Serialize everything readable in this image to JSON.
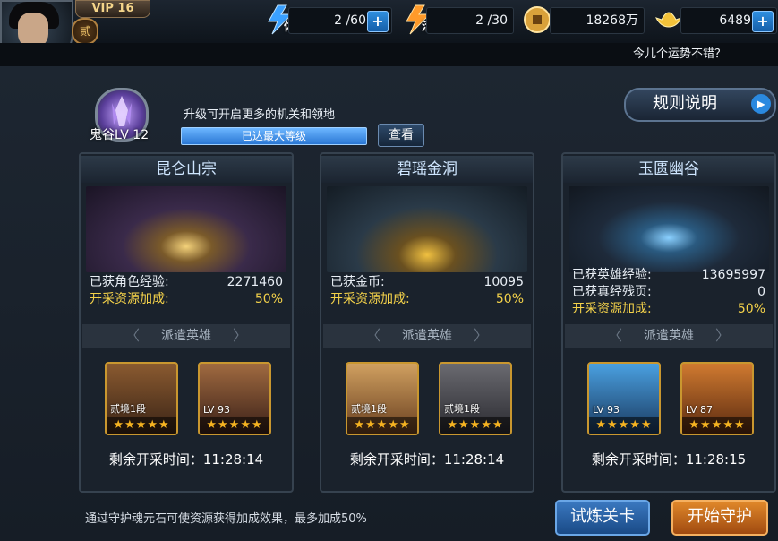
{
  "player": {
    "vip": "VIP 16",
    "rank_badge": "贰"
  },
  "resources": [
    {
      "icon": "stamina-icon",
      "label": "体",
      "value": "2 /60",
      "has_plus": true
    },
    {
      "icon": "energy-icon",
      "label": "活",
      "value": "2 /30",
      "has_plus": false
    },
    {
      "icon": "coin-icon",
      "label": "",
      "value": "18268万",
      "has_plus": false
    },
    {
      "icon": "gold-ingot-icon",
      "label": "",
      "value": "6489",
      "has_plus": true
    }
  ],
  "fortune_text": "今儿个运势不错？",
  "level": {
    "name": "鬼谷LV 12",
    "hint": "升级可开启更多的机关和领地",
    "bar_text": "已达最大等级",
    "progress": 1.0,
    "view_button": "查看"
  },
  "rules_button": "规则说明",
  "panels": [
    {
      "title": "昆仑山宗",
      "stats": [
        {
          "k": "已获角色经验:",
          "v": "2271460",
          "highlight": false
        },
        {
          "k": "开采资源加成:",
          "v": "50%",
          "highlight": true
        }
      ],
      "dispatch": "派遣英雄",
      "heroes": [
        {
          "lv": "贰境1段",
          "stars": "★★★★★"
        },
        {
          "lv": "LV 93",
          "stars": "★★★★★"
        }
      ],
      "timer": "剩余开采时间：11:28:14"
    },
    {
      "title": "碧瑶金洞",
      "stats": [
        {
          "k": "已获金币:",
          "v": "10095",
          "highlight": false
        },
        {
          "k": "开采资源加成:",
          "v": "50%",
          "highlight": true
        }
      ],
      "dispatch": "派遣英雄",
      "heroes": [
        {
          "lv": "贰境1段",
          "stars": "★★★★★"
        },
        {
          "lv": "贰境1段",
          "stars": "★★★★★"
        }
      ],
      "timer": "剩余开采时间：11:28:14"
    },
    {
      "title": "玉匮幽谷",
      "stats": [
        {
          "k": "已获英雄经验:",
          "v": "13695997",
          "highlight": false
        },
        {
          "k": "已获真经残页:",
          "v": "0",
          "highlight": false
        },
        {
          "k": "开采资源加成:",
          "v": "50%",
          "highlight": true
        }
      ],
      "dispatch": "派遣英雄",
      "heroes": [
        {
          "lv": "LV 93",
          "stars": "★★★★★"
        },
        {
          "lv": "LV 87",
          "stars": "★★★★★"
        }
      ],
      "timer": "剩余开采时间：11:28:15"
    }
  ],
  "footer_note": "通过守护魂元石可使资源获得加成效果，最多加成50%",
  "buttons": {
    "trial": "试炼关卡",
    "guard": "开始守护"
  }
}
